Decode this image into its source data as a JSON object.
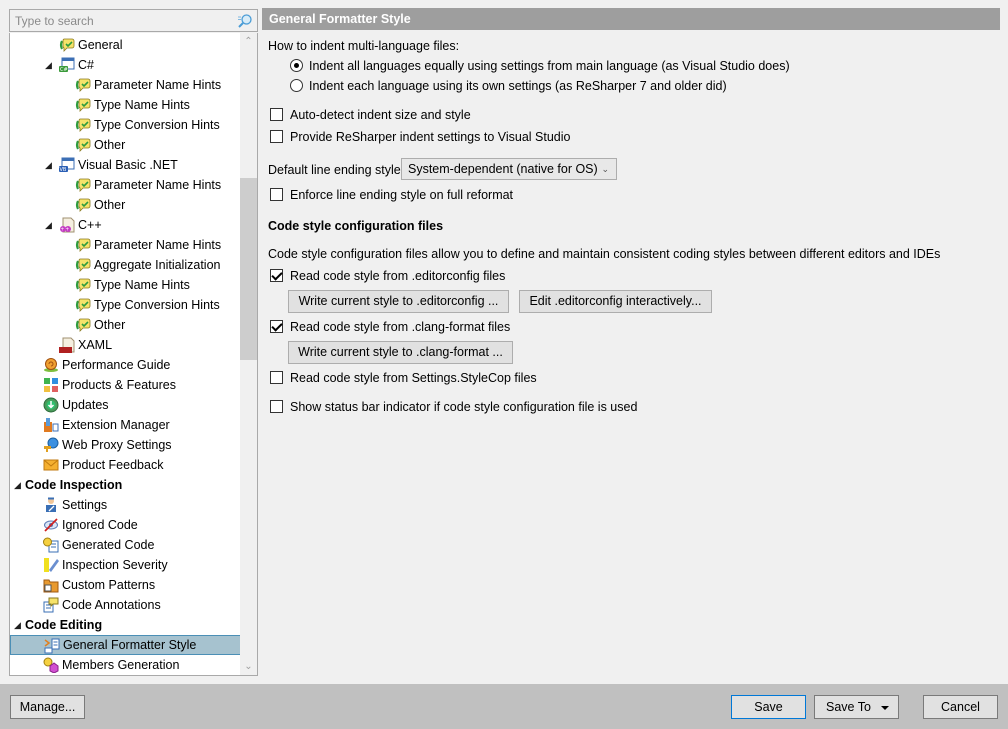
{
  "search": {
    "placeholder": "Type to search",
    "value": ""
  },
  "tree": {
    "items": [
      {
        "label": "General",
        "level": 3,
        "icon": "inlay-hints-icon",
        "expander": ""
      },
      {
        "label": "C#",
        "level": 2,
        "icon": "csharp-icon",
        "expander": "expanded"
      },
      {
        "label": "Parameter Name Hints",
        "level": 4,
        "icon": "inlay-hints-icon",
        "expander": ""
      },
      {
        "label": "Type Name Hints",
        "level": 4,
        "icon": "inlay-hints-icon",
        "expander": ""
      },
      {
        "label": "Type Conversion Hints",
        "level": 4,
        "icon": "inlay-hints-icon",
        "expander": ""
      },
      {
        "label": "Other",
        "level": 4,
        "icon": "inlay-hints-icon",
        "expander": ""
      },
      {
        "label": "Visual Basic .NET",
        "level": 2,
        "icon": "vbnet-icon",
        "expander": "expanded"
      },
      {
        "label": "Parameter Name Hints",
        "level": 4,
        "icon": "inlay-hints-icon",
        "expander": ""
      },
      {
        "label": "Other",
        "level": 4,
        "icon": "inlay-hints-icon",
        "expander": ""
      },
      {
        "label": "C++",
        "level": 2,
        "icon": "cpp-icon",
        "expander": "expanded"
      },
      {
        "label": "Parameter Name Hints",
        "level": 4,
        "icon": "inlay-hints-icon",
        "expander": ""
      },
      {
        "label": "Aggregate Initialization",
        "level": 4,
        "icon": "inlay-hints-icon",
        "expander": ""
      },
      {
        "label": "Type Name Hints",
        "level": 4,
        "icon": "inlay-hints-icon",
        "expander": ""
      },
      {
        "label": "Type Conversion Hints",
        "level": 4,
        "icon": "inlay-hints-icon",
        "expander": ""
      },
      {
        "label": "Other",
        "level": 4,
        "icon": "inlay-hints-icon",
        "expander": ""
      },
      {
        "label": "XAML",
        "level": 3,
        "icon": "xaml-icon",
        "expander": ""
      },
      {
        "label": "Performance Guide",
        "level": 1,
        "icon": "snail-icon",
        "expander": ""
      },
      {
        "label": "Products & Features",
        "level": 1,
        "icon": "products-icon",
        "expander": ""
      },
      {
        "label": "Updates",
        "level": 1,
        "icon": "updates-icon",
        "expander": ""
      },
      {
        "label": "Extension Manager",
        "level": 1,
        "icon": "extension-icon",
        "expander": ""
      },
      {
        "label": "Web Proxy Settings",
        "level": 1,
        "icon": "web-proxy-icon",
        "expander": ""
      },
      {
        "label": "Product Feedback",
        "level": 1,
        "icon": "envelope-icon",
        "expander": ""
      },
      {
        "label": "Code Inspection",
        "level": 0,
        "icon": "",
        "expander": "expanded",
        "bold": true
      },
      {
        "label": "Settings",
        "level": 1,
        "icon": "inspector-icon",
        "expander": ""
      },
      {
        "label": "Ignored Code",
        "level": 1,
        "icon": "ignored-eye-icon",
        "expander": ""
      },
      {
        "label": "Generated Code",
        "level": 1,
        "icon": "generated-code-icon",
        "expander": ""
      },
      {
        "label": "Inspection Severity",
        "level": 1,
        "icon": "severity-icon",
        "expander": ""
      },
      {
        "label": "Custom Patterns",
        "level": 1,
        "icon": "custom-patterns-icon",
        "expander": ""
      },
      {
        "label": "Code Annotations",
        "level": 1,
        "icon": "annotations-icon",
        "expander": ""
      },
      {
        "label": "Code Editing",
        "level": 0,
        "icon": "",
        "expander": "expanded",
        "bold": true
      },
      {
        "label": "General Formatter Style",
        "level": 1,
        "icon": "formatter-icon",
        "expander": "",
        "selected": true
      },
      {
        "label": "Members Generation",
        "level": 1,
        "icon": "members-generation-icon",
        "expander": ""
      }
    ]
  },
  "page": {
    "title": "General Formatter Style",
    "indent_question": "How to indent multi-language files:",
    "radio_options": [
      {
        "label": "Indent all languages equally using settings from main language (as Visual Studio does)",
        "selected": true
      },
      {
        "label": "Indent each language using its own settings (as ReSharper 7 and older did)",
        "selected": false
      }
    ],
    "auto_detect": {
      "label": "Auto-detect indent size and style",
      "checked": false
    },
    "provide_indent": {
      "label": "Provide ReSharper indent settings to Visual Studio",
      "checked": false
    },
    "line_ending_label": "Default line ending style",
    "line_ending_value": "System-dependent (native for OS)",
    "enforce_line_ending": {
      "label": "Enforce line ending style on full reformat",
      "checked": false
    },
    "config_section_title": "Code style configuration files",
    "config_description": "Code style configuration files allow you to define and maintain consistent coding styles between different editors and IDEs",
    "read_editorconfig": {
      "label": "Read code style from .editorconfig files",
      "checked": true
    },
    "write_editorconfig_button": "Write current style to .editorconfig ...",
    "edit_editorconfig_button": "Edit .editorconfig interactively...",
    "read_clang": {
      "label": "Read code style from .clang-format files",
      "checked": true
    },
    "write_clang_button": "Write current style to .clang-format ...",
    "read_stylecop": {
      "label": "Read code style from Settings.StyleCop files",
      "checked": false
    },
    "status_bar_indicator": {
      "label": "Show status bar indicator if code style configuration file is used",
      "checked": false
    }
  },
  "footer": {
    "manage": "Manage...",
    "save": "Save",
    "save_to": "Save To",
    "cancel": "Cancel"
  },
  "colors": {
    "header_bg": "#9e9e9e",
    "selection_bg": "#a6c2cf",
    "selection_border": "#4b8fb6",
    "footer_bg": "#c0c0c0",
    "default_button_border": "#0078d7"
  }
}
